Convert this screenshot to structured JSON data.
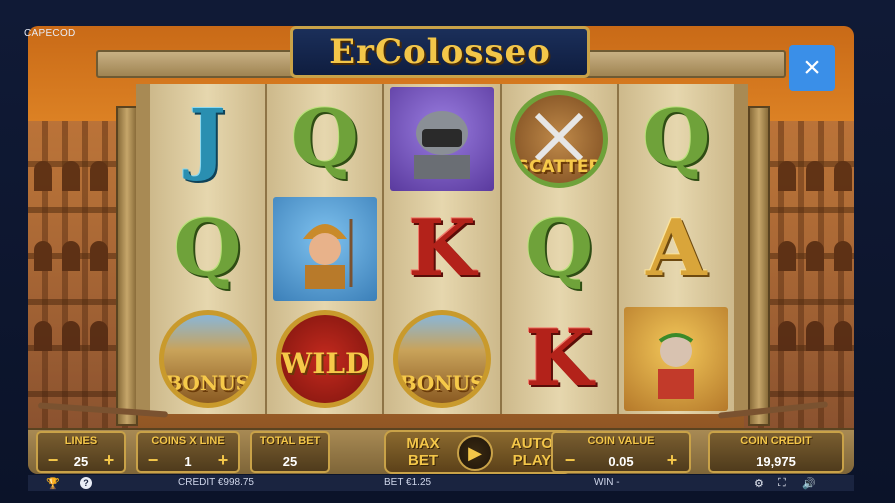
{
  "provider": "CAPECOD",
  "game_title": "Er Colosseo",
  "logo_text": "ErColosseo",
  "close_label": "×",
  "reels": [
    [
      {
        "kind": "letter",
        "value": "J",
        "color": "blue"
      },
      {
        "kind": "letter",
        "value": "Q",
        "color": "green"
      },
      {
        "kind": "bonus",
        "value": "BONUS"
      }
    ],
    [
      {
        "kind": "letter",
        "value": "Q",
        "color": "green"
      },
      {
        "kind": "portrait",
        "value": "soldier-icon"
      },
      {
        "kind": "wild",
        "value": "WILD"
      }
    ],
    [
      {
        "kind": "portrait",
        "value": "gladiator-helmet-icon"
      },
      {
        "kind": "letter",
        "value": "K",
        "color": "red"
      },
      {
        "kind": "bonus",
        "value": "BONUS"
      }
    ],
    [
      {
        "kind": "scatter",
        "value": "SCATTER"
      },
      {
        "kind": "letter",
        "value": "Q",
        "color": "green"
      },
      {
        "kind": "letter",
        "value": "K",
        "color": "red"
      }
    ],
    [
      {
        "kind": "letter",
        "value": "Q",
        "color": "green"
      },
      {
        "kind": "letter",
        "value": "A",
        "color": "gold"
      },
      {
        "kind": "portrait",
        "value": "emperor-thumbs-down-icon"
      }
    ]
  ],
  "controls": {
    "lines_label": "LINES",
    "lines_value": "25",
    "coins_x_line_label": "COINS X LINE",
    "coins_x_line_value": "1",
    "total_bet_label": "TOTAL BET",
    "total_bet_value": "25",
    "max_bet_label_1": "MAX",
    "max_bet_label_2": "BET",
    "auto_play_label_1": "AUTO",
    "auto_play_label_2": "PLAY",
    "coin_value_label": "COIN VALUE",
    "coin_value_value": "0.05",
    "coin_credit_label": "COIN CREDIT",
    "coin_credit_value": "19,975",
    "minus": "−",
    "plus": "+"
  },
  "status_bar": {
    "credit": "CREDIT €998.75",
    "bet": "BET €1.25",
    "win": "WIN -"
  },
  "colors": {
    "accent": "#f3c649",
    "close_button": "#3a8fe8",
    "panel_border": "#c9a248"
  }
}
